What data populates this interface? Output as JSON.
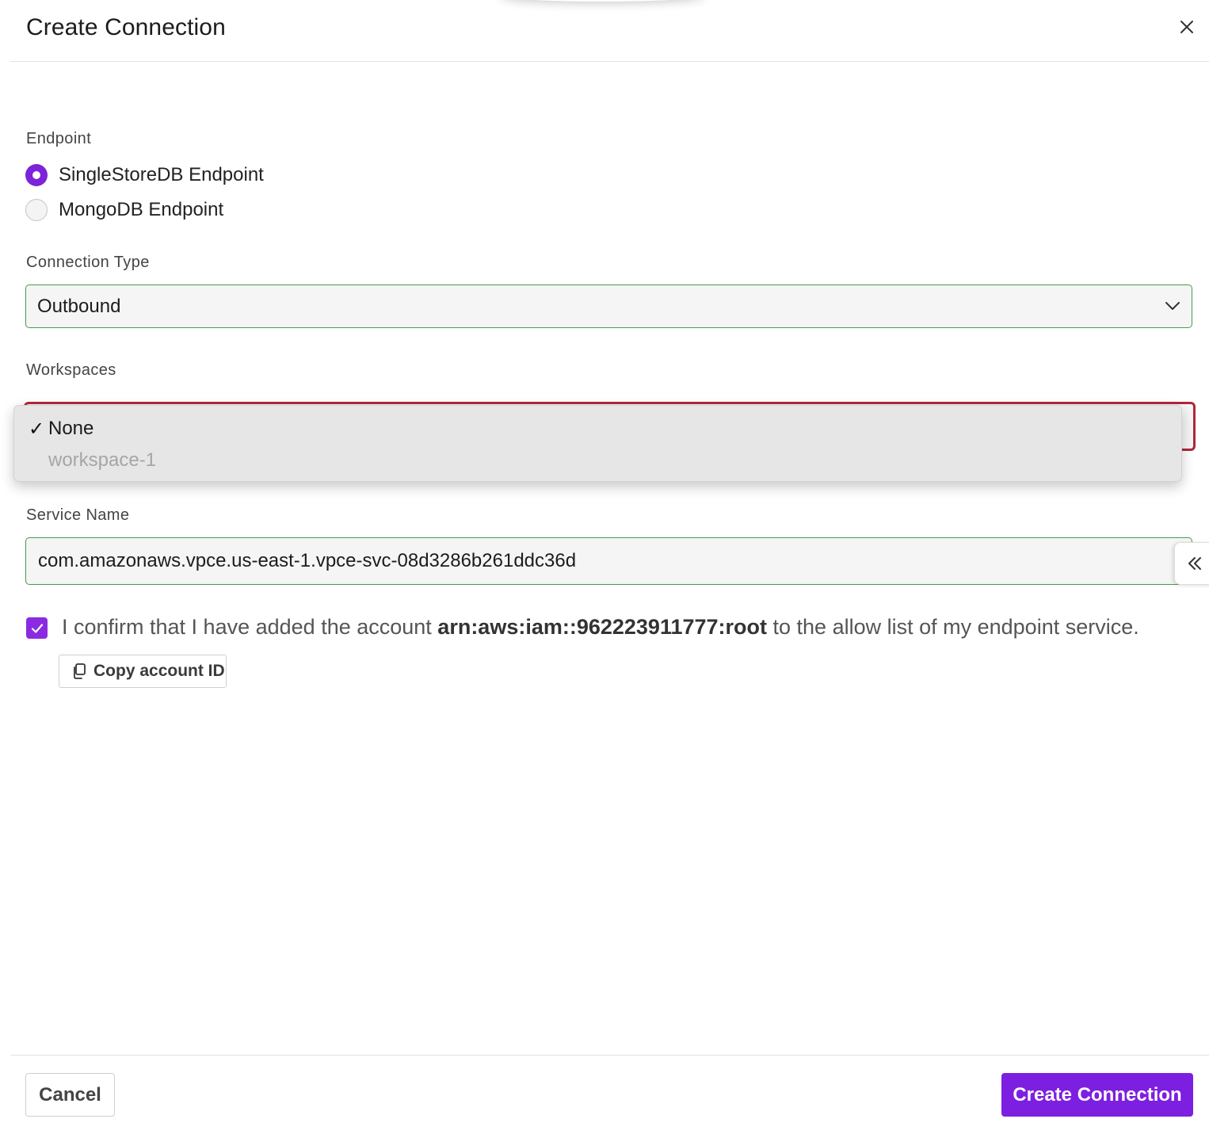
{
  "dialog": {
    "title": "Create Connection"
  },
  "endpoint": {
    "label": "Endpoint",
    "options": [
      {
        "label": "SingleStoreDB Endpoint",
        "selected": true
      },
      {
        "label": "MongoDB Endpoint",
        "selected": false
      }
    ]
  },
  "connection_type": {
    "label": "Connection Type",
    "value": "Outbound"
  },
  "workspaces": {
    "label": "Workspaces",
    "options": [
      {
        "label": "None",
        "selected": true,
        "check": "✓"
      },
      {
        "label": "workspace-1",
        "selected": false,
        "disabled": true
      }
    ]
  },
  "service_name": {
    "label": "Service Name",
    "value": "com.amazonaws.vpce.us-east-1.vpce-svc-08d3286b261ddc36d"
  },
  "confirm": {
    "checked": true,
    "text_before": "I confirm that I have added the account ",
    "account": "arn:aws:iam::962223911777:root",
    "text_after": " to the allow list of my endpoint service."
  },
  "copy_button": {
    "label": "Copy account ID"
  },
  "footer": {
    "cancel_label": "Cancel",
    "create_label": "Create Connection"
  },
  "colors": {
    "accent": "#7d1fe0",
    "valid_border": "#4a9a4c",
    "error_border": "#b0263a"
  }
}
